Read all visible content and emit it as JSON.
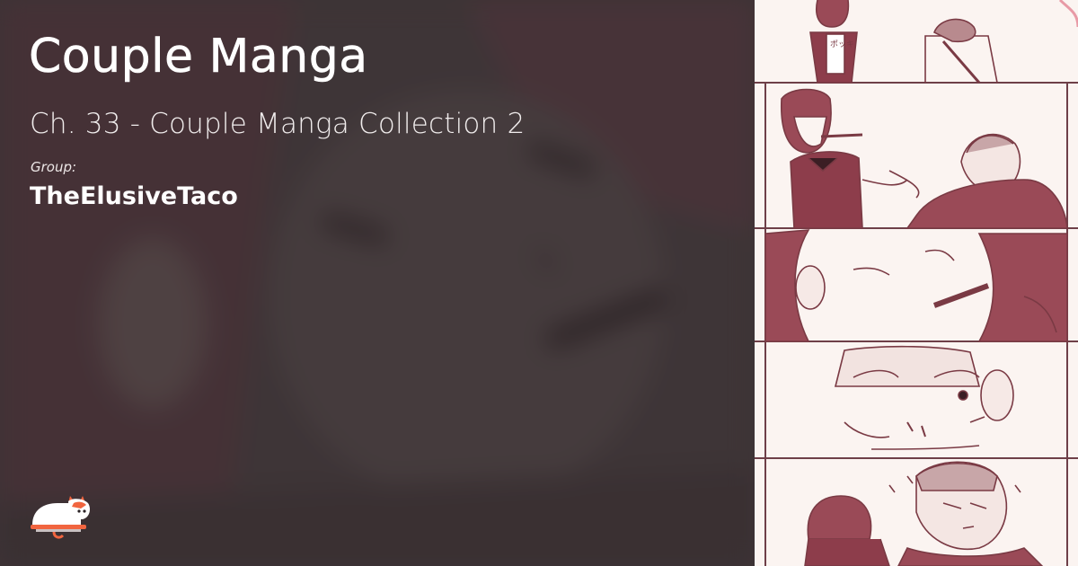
{
  "title": "Couple Manga",
  "chapter": "Ch. 33 - Couple Manga Collection 2",
  "group": {
    "label": "Group:",
    "name": "TheElusiveTaco"
  },
  "logo": {
    "icon": "cat-logo-icon"
  },
  "colors": {
    "accent": "#f1653f",
    "background_tint": "#4c3f41",
    "strip_paper": "#fbf4f1",
    "strip_ink": "#7a3a44"
  },
  "strip": {
    "kana": "ポッキ"
  }
}
